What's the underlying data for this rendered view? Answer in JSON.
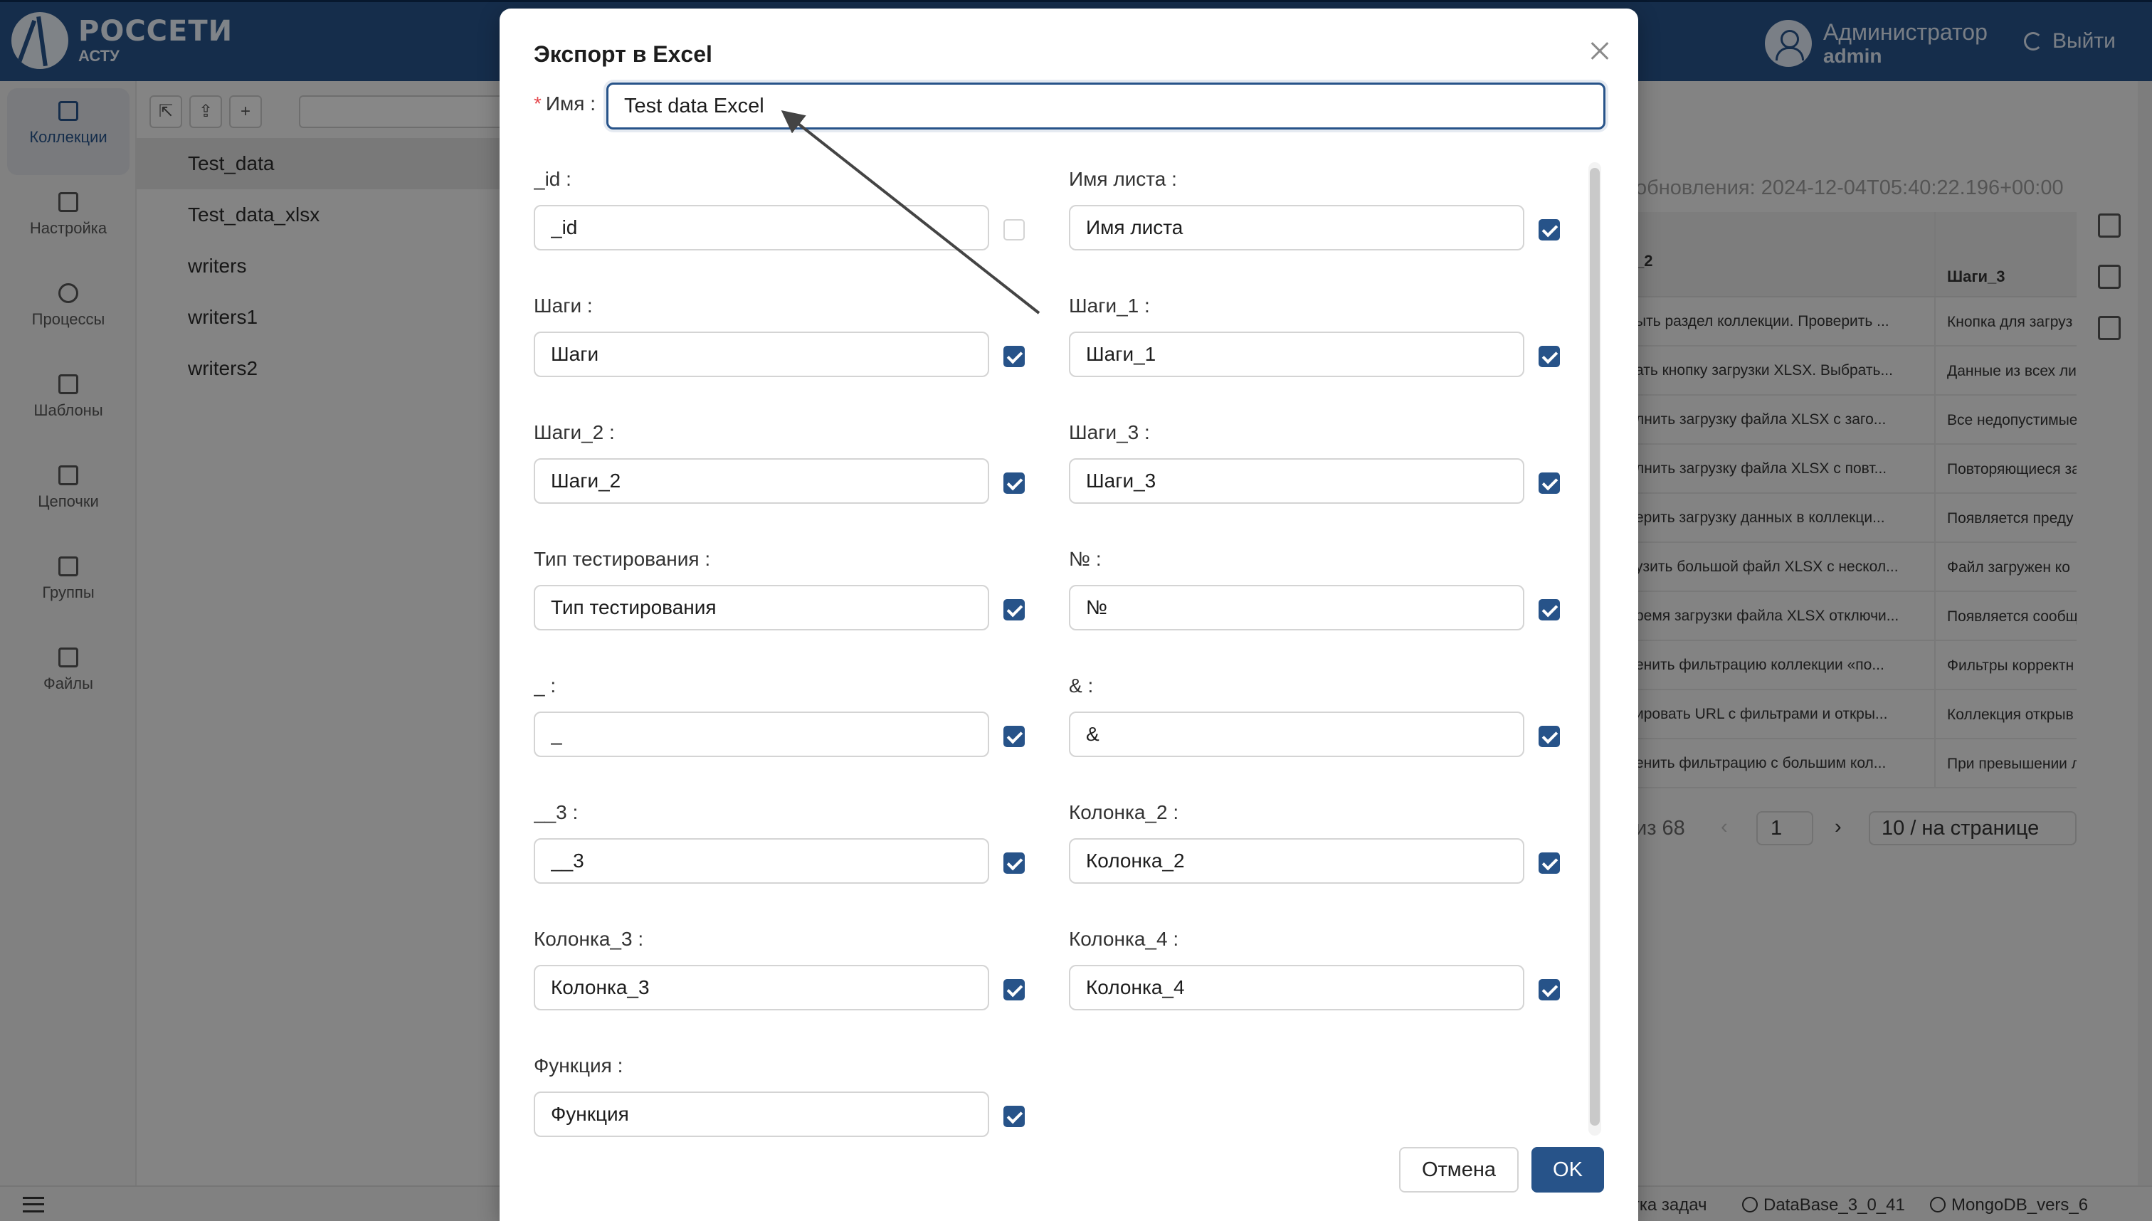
{
  "app": {
    "logo_title": "РОССЕТИ",
    "logo_subtitle": "АСТУ",
    "user_name": "Администратор",
    "user_login": "admin",
    "logout_label": "Выйти"
  },
  "sidebar": {
    "items": [
      {
        "label": "Коллекции",
        "icon": "collections-icon"
      },
      {
        "label": "Настройка",
        "icon": "settings-icon"
      },
      {
        "label": "Процессы",
        "icon": "play-icon"
      },
      {
        "label": "Шаблоны",
        "icon": "templates-icon"
      },
      {
        "label": "Цепочки",
        "icon": "chains-icon"
      },
      {
        "label": "Группы",
        "icon": "groups-icon"
      },
      {
        "label": "Файлы",
        "icon": "folder-icon"
      }
    ]
  },
  "collections": [
    "Test_data",
    "Test_data_xlsx",
    "writers",
    "writers1",
    "writers2"
  ],
  "right_panel": {
    "updated_text": "обновления: 2024-12-04T05:40:22.196+00:00",
    "columns": [
      "_2",
      "Шаги_3"
    ],
    "rows": [
      [
        "ыть раздел коллекции. Проверить ...",
        "Кнопка для загруз"
      ],
      [
        "ать кнопку загрузки XLSX. Выбрать...",
        "Данные из всех ли"
      ],
      [
        "лнить загрузку файла XLSX с заго...",
        "Все недопустимые"
      ],
      [
        "лнить загрузку файла XLSX с повт...",
        "Повторяющиеся за"
      ],
      [
        "ерить загрузку данных в коллекци...",
        "Появляется преду"
      ],
      [
        "узить большой файл XLSX с нескол...",
        "Файл загружен ко"
      ],
      [
        "ремя загрузки файла XLSX отключи...",
        "Появляется сообщ"
      ],
      [
        "енить фильтрацию коллекции «по...",
        "Фильтры корректн"
      ],
      [
        "ировать URL с фильтрами и откры...",
        "Коллекция открыв"
      ],
      [
        "енить фильтрацию с большим кол...",
        "При превышении л"
      ]
    ],
    "pager_total": "из 68",
    "pager_page": "1",
    "pager_size": "10 / на странице"
  },
  "statusbar": {
    "tasks": "отка задач",
    "db1": "DataBase_3_0_41",
    "db2": "MongoDB_vers_6"
  },
  "modal": {
    "title": "Экспорт в Excel",
    "name_label": "Имя",
    "name_value": "Test data Excel",
    "fields": [
      {
        "label": "_id",
        "value": "_id",
        "checked": false
      },
      {
        "label": "Имя листа",
        "value": "Имя листа",
        "checked": true
      },
      {
        "label": "Шаги",
        "value": "Шаги",
        "checked": true
      },
      {
        "label": "Шаги_1",
        "value": "Шаги_1",
        "checked": true
      },
      {
        "label": "Шаги_2",
        "value": "Шаги_2",
        "checked": true
      },
      {
        "label": "Шаги_3",
        "value": "Шаги_3",
        "checked": true
      },
      {
        "label": "Тип тестирования",
        "value": "Тип тестирования",
        "checked": true
      },
      {
        "label": "№",
        "value": "№",
        "checked": true
      },
      {
        "label": "_",
        "value": "_",
        "checked": true
      },
      {
        "label": "&",
        "value": "&",
        "checked": true
      },
      {
        "label": "__3",
        "value": "__3",
        "checked": true
      },
      {
        "label": "Колонка_2",
        "value": "Колонка_2",
        "checked": true
      },
      {
        "label": "Колонка_3",
        "value": "Колонка_3",
        "checked": true
      },
      {
        "label": "Колонка_4",
        "value": "Колонка_4",
        "checked": true
      },
      {
        "label": "Функция",
        "value": "Функция",
        "checked": true
      }
    ],
    "cancel_label": "Отмена",
    "ok_label": "OK"
  },
  "colors": {
    "brand": "#275389",
    "overlay": "#000000"
  }
}
